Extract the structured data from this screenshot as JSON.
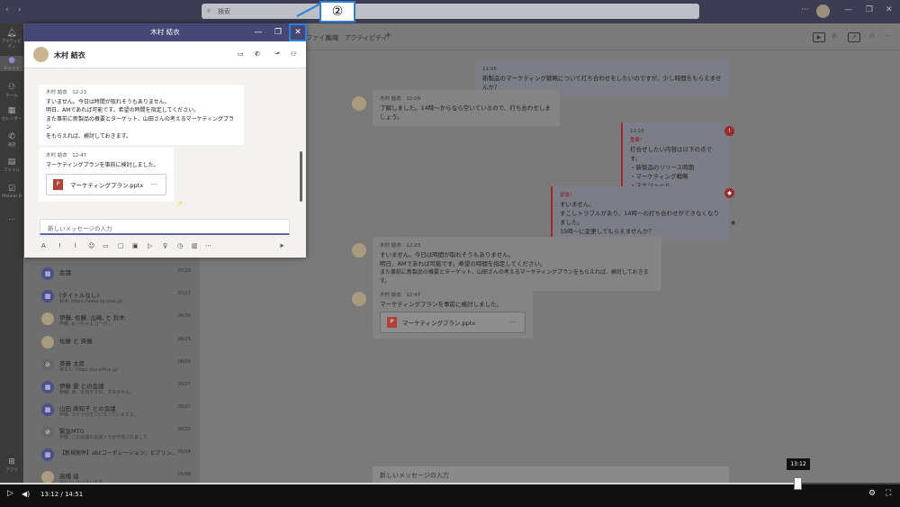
{
  "search": {
    "placeholder": "検索"
  },
  "rail": [
    {
      "icon": "bell-icon",
      "label": "アクティビティ"
    },
    {
      "icon": "chat-icon",
      "label": "チャット"
    },
    {
      "icon": "team-icon",
      "label": "チーム"
    },
    {
      "icon": "calendar-icon",
      "label": "カレンダー"
    },
    {
      "icon": "phone-icon",
      "label": "通話"
    },
    {
      "icon": "file-icon",
      "label": "ファイル"
    },
    {
      "icon": "planner-icon",
      "label": "Planner B"
    },
    {
      "icon": "more-icon",
      "label": "..."
    },
    {
      "icon": "apps-icon",
      "label": "アプリ"
    }
  ],
  "chat_list": [
    {
      "title": "会議",
      "sub": "",
      "date": "07/23"
    },
    {
      "title": "(タイトルなし)",
      "sub": "鈴木: https://www.sg-plus.jp/",
      "date": "07/17"
    },
    {
      "title": "伊藤, 佐藤, 山崎, と 鈴木",
      "sub": "伊藤: めっちゃエコーが、、",
      "date": "06/30"
    },
    {
      "title": "佐藤 と 斉藤",
      "sub": "",
      "date": "06/25"
    },
    {
      "title": "斉藤 太郎",
      "sub": "あなた: https://ez-office.jp/",
      "date": "06/09"
    },
    {
      "title": "伊藤 愛 との会議",
      "sub": "伊藤: あ、本当ですね、すみません。",
      "date": "05/27"
    },
    {
      "title": "山田 真知子 との会議",
      "sub": "伊藤: マイクがオフになっていますよ。",
      "date": "05/27"
    },
    {
      "title": "緊急MTG",
      "sub": "伊藤: この会議の会議メモが作成されました",
      "date": "05/25"
    },
    {
      "title": "【新規案件】abcコーポレーション：ヒアリン...",
      "sub": "",
      "date": "05/14"
    },
    {
      "title": "高橋 遥",
      "sub": "あなた: はいはいます。",
      "date": "05/08"
    },
    {
      "title": "",
      "sub": "あなた: https://teams.microsoft.com/l/meetup-joi...",
      "date": "05/08"
    }
  ],
  "main": {
    "tabs": [
      "ファイル",
      "組織",
      "アクティビティ",
      "+"
    ],
    "msg1": {
      "time": "12:05",
      "text": "新製品のマーケティング戦略について打ち合わせをしたいのですが、少し時間をもらえませんか？"
    },
    "msg2": {
      "name": "木村 結衣",
      "time": "12:09",
      "text": "了解しました。14時～からなら空いているので、打ち合わせしましょう。"
    },
    "msg3": {
      "time": "12:15",
      "flag": "重要!",
      "lines": [
        "打合せしたい内容は以下の点です。",
        "・新製品のリリース時期",
        "・マーケティング戦略",
        "・スケジュール"
      ]
    },
    "msg4": {
      "flag": "緊急!",
      "lines": [
        "すいません。",
        "すこしトラブルがあり、14時～の打ち合わせができなくなりました。",
        "15時～に変更してもらえませんか？"
      ]
    },
    "msg5": {
      "name": "木村 結衣",
      "time": "12:23",
      "lines": [
        "すいません。今日は時間が取れそうもありません。",
        "明日、AMであれば可能です。希望の時間を指定してください。",
        "また事前に新製品の概要とターゲット、山田さんの考えるマーケティングプランをもらえれば、検討しておきます。"
      ]
    },
    "msg6": {
      "name": "木村 結衣",
      "time": "12:47",
      "text": "マーケティングプランを事前に検討しました。",
      "file": "マーケティングプラン.pptx",
      "more": "..."
    },
    "compose_placeholder": "新しいメッセージの入力"
  },
  "popout": {
    "title": "木村 結衣",
    "header_name": "木村 結衣",
    "msgA": {
      "name": "木村 結衣",
      "time": "12:23",
      "lines": [
        "すいません。今日は時間が取れそうもありません。",
        "明日、AMであれば可能です。希望の時間を指定してください。",
        "また事前に新製品の概要とターゲット、山田さんの考えるマーケティングプラン",
        "をもらえれば、検討しておきます。"
      ]
    },
    "msgB": {
      "name": "木村 結衣",
      "time": "12:47",
      "text": "マーケティングプランを事前に検討しました。",
      "file": "マーケティングプラン.pptx",
      "more": "..."
    },
    "compose_placeholder": "新しいメッセージの入力"
  },
  "callout": "②",
  "video": {
    "current": "13:12",
    "total": "14:51",
    "time_label": "13:12 / 14:51",
    "progress": 0.886
  }
}
